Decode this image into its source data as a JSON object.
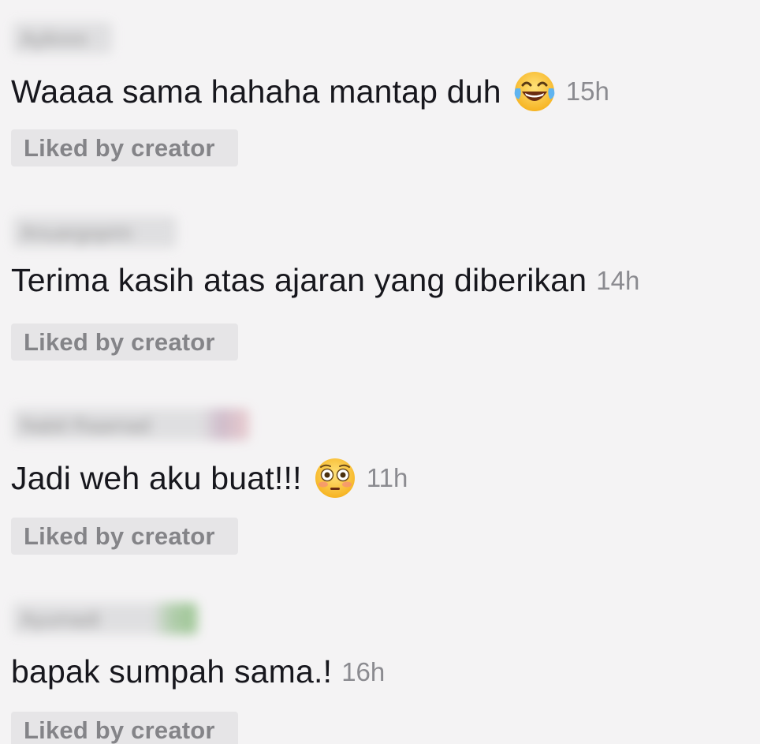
{
  "comments": [
    {
      "username": "Aylinnn",
      "text": "Waaaa sama hahaha mantap duh",
      "emoji": "face-with-tears-of-joy",
      "time": "15h",
      "badge": "Liked by creator"
    },
    {
      "username": "Anuargoprin",
      "text": "Terima kasih atas ajaran yang diberikan",
      "emoji": "",
      "time": "14h",
      "badge": "Liked by creator"
    },
    {
      "username": "Nabil Raamad",
      "text": "Jadi weh aku buat!!!",
      "emoji": "flushed-face",
      "time": "11h",
      "badge": "Liked by creator"
    },
    {
      "username": "Ayumadi",
      "text": "bapak sumpah sama.!",
      "emoji": "",
      "time": "16h",
      "badge": "Liked by creator"
    }
  ],
  "colors": {
    "background": "#f4f3f4",
    "text": "#17171d",
    "time": "#8b8b90",
    "badge_bg": "#e6e5e7",
    "badge_text": "#848488"
  }
}
